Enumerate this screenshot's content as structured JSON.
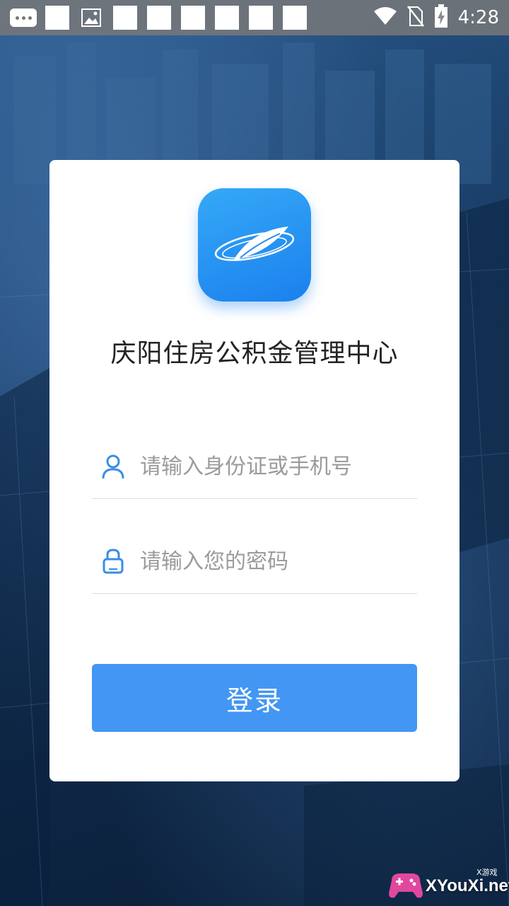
{
  "status_bar": {
    "time": "4:28",
    "icons": [
      "more-icon",
      "square-icon",
      "image-icon",
      "square-icon",
      "square-icon",
      "square-icon",
      "square-icon",
      "square-icon",
      "square-icon",
      "wifi-icon",
      "no-sim-icon",
      "battery-charging-icon"
    ]
  },
  "app": {
    "logo": "feather-logo-icon",
    "title": "庆阳住房公积金管理中心"
  },
  "login": {
    "username_placeholder": "请输入身份证或手机号",
    "username_value": "",
    "password_placeholder": "请输入您的密码",
    "password_value": "",
    "submit_label": "登录"
  },
  "watermark": {
    "text": "XYouXi.net",
    "sub": "X游戏"
  },
  "colors": {
    "accent": "#4396f3",
    "logo_gradient_top": "#35a9f7",
    "logo_gradient_bottom": "#1b80ee",
    "background": "#173a63"
  }
}
